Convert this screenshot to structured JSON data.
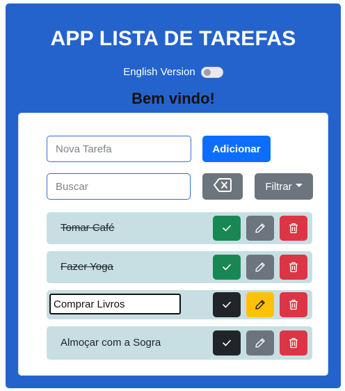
{
  "app": {
    "title": "APP LISTA DE TAREFAS",
    "language_toggle_label": "English Version",
    "welcome": "Bem vindo!"
  },
  "add_form": {
    "placeholder": "Nova Tarefa",
    "button_label": "Adicionar"
  },
  "search": {
    "placeholder": "Buscar",
    "clear_icon": "backspace-icon",
    "filter_label": "Filtrar"
  },
  "tasks": [
    {
      "label": "Tomar Café",
      "done": true,
      "editing": false
    },
    {
      "label": "Fazer Yoga",
      "done": true,
      "editing": false
    },
    {
      "label": "Comprar Livros",
      "done": false,
      "editing": true
    },
    {
      "label": "Almoçar com a Sogra",
      "done": false,
      "editing": false
    }
  ],
  "icons": {
    "check": "check-icon",
    "edit": "pencil-icon",
    "delete": "trash-icon"
  },
  "colors": {
    "header_bg": "#2563cc",
    "primary": "#0d6efd",
    "secondary": "#6c757d",
    "success": "#198754",
    "dark": "#212529",
    "warning": "#ffc107",
    "danger": "#dc3545",
    "task_bg": "#c7dfe3"
  }
}
